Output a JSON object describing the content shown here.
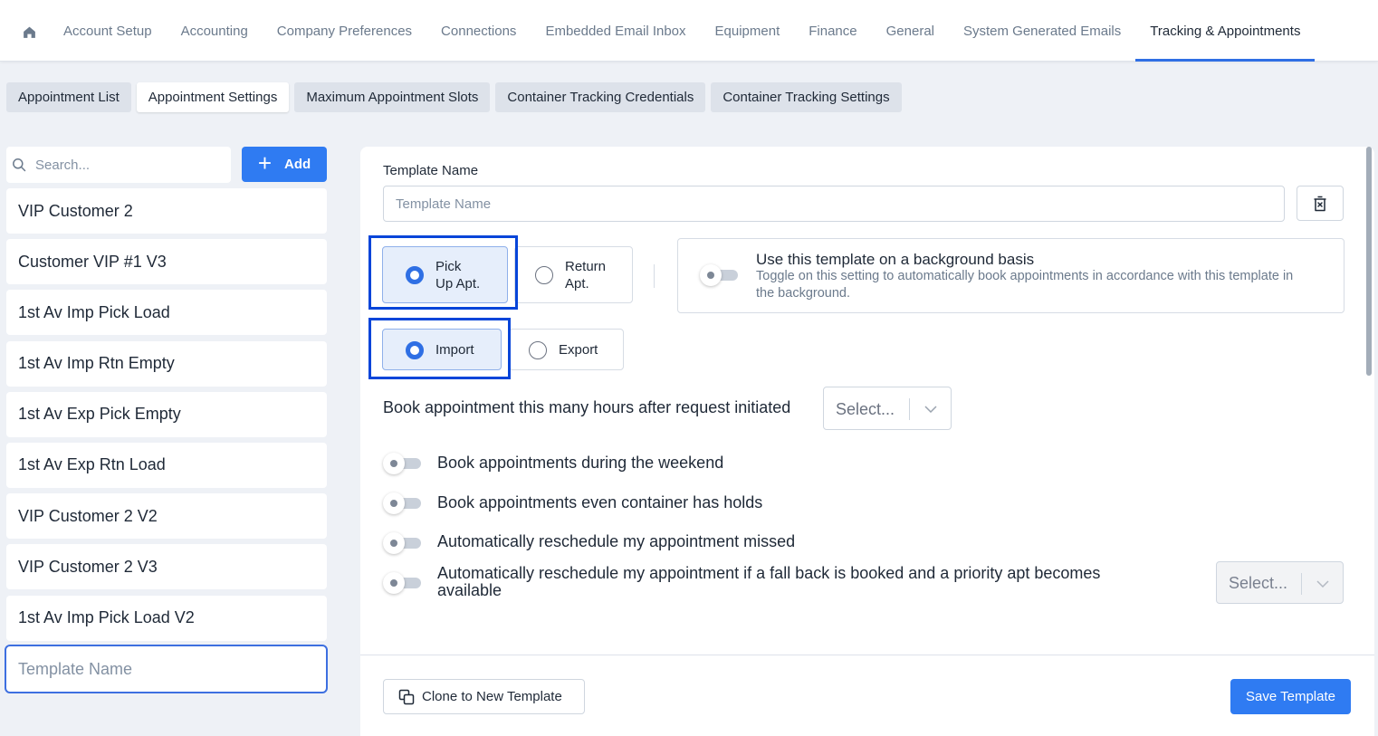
{
  "top_nav": {
    "home_icon": "home-icon",
    "tabs": [
      "Account Setup",
      "Accounting",
      "Company Preferences",
      "Connections",
      "Embedded Email Inbox",
      "Equipment",
      "Finance",
      "General",
      "System Generated Emails",
      "Tracking & Appointments"
    ],
    "active_tab": "Tracking & Appointments"
  },
  "sub_tabs": {
    "items": [
      "Appointment List",
      "Appointment Settings",
      "Maximum Appointment Slots",
      "Container Tracking Credentials",
      "Container Tracking Settings"
    ],
    "active": "Appointment Settings"
  },
  "sidebar": {
    "search_placeholder": "Search...",
    "add_label": "Add",
    "templates": [
      "VIP Customer 2",
      "Customer VIP #1 V3",
      "1st Av Imp Pick Load",
      "1st Av Imp Rtn Empty",
      "1st Av Exp Pick Empty",
      "1st Av Exp Rtn Load",
      "VIP Customer 2 V2",
      "VIP Customer 2 V3",
      "1st Av Imp Pick Load V2"
    ],
    "new_template_placeholder": "Template Name"
  },
  "form": {
    "template_name_label": "Template Name",
    "template_name_placeholder": "Template Name",
    "apt_type": {
      "options": [
        {
          "line1": "Pick",
          "line2": "Up Apt.",
          "selected": true
        },
        {
          "line1": "Return",
          "line2": "Apt.",
          "selected": false
        }
      ]
    },
    "move_type": {
      "options": [
        {
          "label": "Import",
          "selected": true
        },
        {
          "label": "Export",
          "selected": false
        }
      ]
    },
    "background": {
      "title": "Use this template on a background basis",
      "description": "Toggle on this setting to automatically book appointments in accordance with this template in the background.",
      "enabled": false
    },
    "hours_label": "Book appointment this many hours after request initiated",
    "hours_select": "Select...",
    "toggles": [
      {
        "label": "Book appointments during the weekend",
        "enabled": false
      },
      {
        "label": "Book appointments even container has holds",
        "enabled": false
      },
      {
        "label": "Automatically reschedule my appointment missed",
        "enabled": false
      },
      {
        "label": "Automatically reschedule my appointment if a fall back is booked and a priority apt becomes available",
        "enabled": false
      }
    ],
    "priority_select": "Select...",
    "clone_label": "Clone to New Template",
    "save_label": "Save Template"
  },
  "colors": {
    "accent": "#2f7bf2",
    "highlight": "#0745d9",
    "background": "#eef1f6"
  }
}
